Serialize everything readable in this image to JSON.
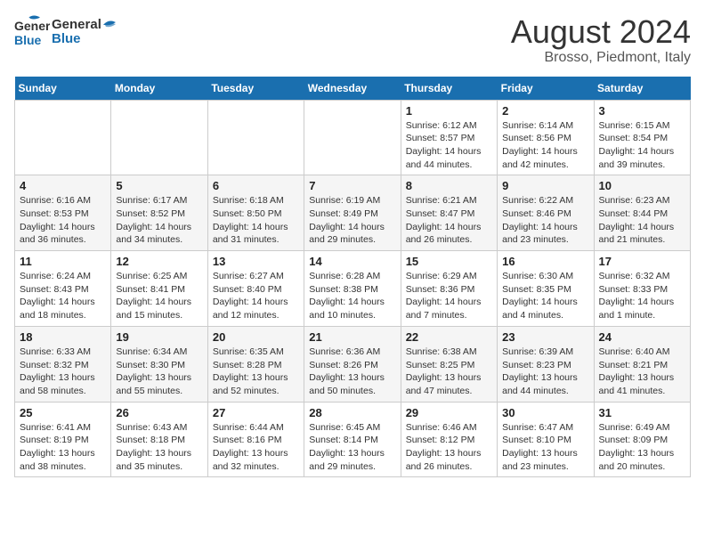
{
  "header": {
    "logo_general": "General",
    "logo_blue": "Blue",
    "main_title": "August 2024",
    "subtitle": "Brosso, Piedmont, Italy"
  },
  "weekdays": [
    "Sunday",
    "Monday",
    "Tuesday",
    "Wednesday",
    "Thursday",
    "Friday",
    "Saturday"
  ],
  "weeks": [
    [
      {
        "day": "",
        "sunrise": "",
        "sunset": "",
        "daylight": ""
      },
      {
        "day": "",
        "sunrise": "",
        "sunset": "",
        "daylight": ""
      },
      {
        "day": "",
        "sunrise": "",
        "sunset": "",
        "daylight": ""
      },
      {
        "day": "",
        "sunrise": "",
        "sunset": "",
        "daylight": ""
      },
      {
        "day": "1",
        "sunrise": "Sunrise: 6:12 AM",
        "sunset": "Sunset: 8:57 PM",
        "daylight": "Daylight: 14 hours and 44 minutes."
      },
      {
        "day": "2",
        "sunrise": "Sunrise: 6:14 AM",
        "sunset": "Sunset: 8:56 PM",
        "daylight": "Daylight: 14 hours and 42 minutes."
      },
      {
        "day": "3",
        "sunrise": "Sunrise: 6:15 AM",
        "sunset": "Sunset: 8:54 PM",
        "daylight": "Daylight: 14 hours and 39 minutes."
      }
    ],
    [
      {
        "day": "4",
        "sunrise": "Sunrise: 6:16 AM",
        "sunset": "Sunset: 8:53 PM",
        "daylight": "Daylight: 14 hours and 36 minutes."
      },
      {
        "day": "5",
        "sunrise": "Sunrise: 6:17 AM",
        "sunset": "Sunset: 8:52 PM",
        "daylight": "Daylight: 14 hours and 34 minutes."
      },
      {
        "day": "6",
        "sunrise": "Sunrise: 6:18 AM",
        "sunset": "Sunset: 8:50 PM",
        "daylight": "Daylight: 14 hours and 31 minutes."
      },
      {
        "day": "7",
        "sunrise": "Sunrise: 6:19 AM",
        "sunset": "Sunset: 8:49 PM",
        "daylight": "Daylight: 14 hours and 29 minutes."
      },
      {
        "day": "8",
        "sunrise": "Sunrise: 6:21 AM",
        "sunset": "Sunset: 8:47 PM",
        "daylight": "Daylight: 14 hours and 26 minutes."
      },
      {
        "day": "9",
        "sunrise": "Sunrise: 6:22 AM",
        "sunset": "Sunset: 8:46 PM",
        "daylight": "Daylight: 14 hours and 23 minutes."
      },
      {
        "day": "10",
        "sunrise": "Sunrise: 6:23 AM",
        "sunset": "Sunset: 8:44 PM",
        "daylight": "Daylight: 14 hours and 21 minutes."
      }
    ],
    [
      {
        "day": "11",
        "sunrise": "Sunrise: 6:24 AM",
        "sunset": "Sunset: 8:43 PM",
        "daylight": "Daylight: 14 hours and 18 minutes."
      },
      {
        "day": "12",
        "sunrise": "Sunrise: 6:25 AM",
        "sunset": "Sunset: 8:41 PM",
        "daylight": "Daylight: 14 hours and 15 minutes."
      },
      {
        "day": "13",
        "sunrise": "Sunrise: 6:27 AM",
        "sunset": "Sunset: 8:40 PM",
        "daylight": "Daylight: 14 hours and 12 minutes."
      },
      {
        "day": "14",
        "sunrise": "Sunrise: 6:28 AM",
        "sunset": "Sunset: 8:38 PM",
        "daylight": "Daylight: 14 hours and 10 minutes."
      },
      {
        "day": "15",
        "sunrise": "Sunrise: 6:29 AM",
        "sunset": "Sunset: 8:36 PM",
        "daylight": "Daylight: 14 hours and 7 minutes."
      },
      {
        "day": "16",
        "sunrise": "Sunrise: 6:30 AM",
        "sunset": "Sunset: 8:35 PM",
        "daylight": "Daylight: 14 hours and 4 minutes."
      },
      {
        "day": "17",
        "sunrise": "Sunrise: 6:32 AM",
        "sunset": "Sunset: 8:33 PM",
        "daylight": "Daylight: 14 hours and 1 minute."
      }
    ],
    [
      {
        "day": "18",
        "sunrise": "Sunrise: 6:33 AM",
        "sunset": "Sunset: 8:32 PM",
        "daylight": "Daylight: 13 hours and 58 minutes."
      },
      {
        "day": "19",
        "sunrise": "Sunrise: 6:34 AM",
        "sunset": "Sunset: 8:30 PM",
        "daylight": "Daylight: 13 hours and 55 minutes."
      },
      {
        "day": "20",
        "sunrise": "Sunrise: 6:35 AM",
        "sunset": "Sunset: 8:28 PM",
        "daylight": "Daylight: 13 hours and 52 minutes."
      },
      {
        "day": "21",
        "sunrise": "Sunrise: 6:36 AM",
        "sunset": "Sunset: 8:26 PM",
        "daylight": "Daylight: 13 hours and 50 minutes."
      },
      {
        "day": "22",
        "sunrise": "Sunrise: 6:38 AM",
        "sunset": "Sunset: 8:25 PM",
        "daylight": "Daylight: 13 hours and 47 minutes."
      },
      {
        "day": "23",
        "sunrise": "Sunrise: 6:39 AM",
        "sunset": "Sunset: 8:23 PM",
        "daylight": "Daylight: 13 hours and 44 minutes."
      },
      {
        "day": "24",
        "sunrise": "Sunrise: 6:40 AM",
        "sunset": "Sunset: 8:21 PM",
        "daylight": "Daylight: 13 hours and 41 minutes."
      }
    ],
    [
      {
        "day": "25",
        "sunrise": "Sunrise: 6:41 AM",
        "sunset": "Sunset: 8:19 PM",
        "daylight": "Daylight: 13 hours and 38 minutes."
      },
      {
        "day": "26",
        "sunrise": "Sunrise: 6:43 AM",
        "sunset": "Sunset: 8:18 PM",
        "daylight": "Daylight: 13 hours and 35 minutes."
      },
      {
        "day": "27",
        "sunrise": "Sunrise: 6:44 AM",
        "sunset": "Sunset: 8:16 PM",
        "daylight": "Daylight: 13 hours and 32 minutes."
      },
      {
        "day": "28",
        "sunrise": "Sunrise: 6:45 AM",
        "sunset": "Sunset: 8:14 PM",
        "daylight": "Daylight: 13 hours and 29 minutes."
      },
      {
        "day": "29",
        "sunrise": "Sunrise: 6:46 AM",
        "sunset": "Sunset: 8:12 PM",
        "daylight": "Daylight: 13 hours and 26 minutes."
      },
      {
        "day": "30",
        "sunrise": "Sunrise: 6:47 AM",
        "sunset": "Sunset: 8:10 PM",
        "daylight": "Daylight: 13 hours and 23 minutes."
      },
      {
        "day": "31",
        "sunrise": "Sunrise: 6:49 AM",
        "sunset": "Sunset: 8:09 PM",
        "daylight": "Daylight: 13 hours and 20 minutes."
      }
    ]
  ]
}
